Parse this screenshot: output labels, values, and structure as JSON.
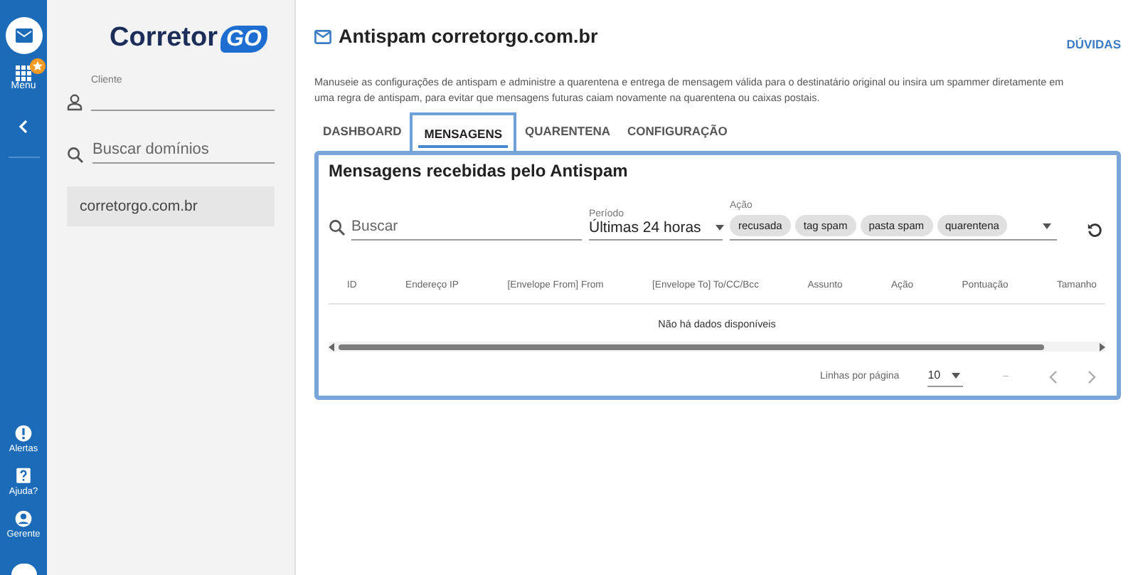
{
  "rail": {
    "menu_label": "Menu",
    "bottom_items": [
      {
        "kind": "alert",
        "label": "Alertas"
      },
      {
        "kind": "help",
        "label": "Ajuda?"
      },
      {
        "kind": "user",
        "label": "Gerente"
      }
    ]
  },
  "sidebar": {
    "logo": {
      "text": "Corretor",
      "mark": "GO"
    },
    "client_field": {
      "label": "Cliente"
    },
    "search": {
      "placeholder": "Buscar domínios"
    },
    "domains": [
      {
        "name": "corretorgo.com.br",
        "selected": true
      }
    ]
  },
  "header": {
    "title": "Antispam corretorgo.com.br",
    "help_link": "DÚVIDAS",
    "description": "Manuseie as configurações de antispam e administre a quarentena e entrega de mensagem válida para o destinatário original ou insira um spammer diretamente em uma regra de antispam, para evitar que mensagens futuras caiam novamente na quarentena ou caixas postais."
  },
  "tabs": [
    {
      "label": "DASHBOARD",
      "selected": false
    },
    {
      "label": "MENSAGENS",
      "selected": true
    },
    {
      "label": "QUARENTENA",
      "selected": false
    },
    {
      "label": "CONFIGURAÇÃO",
      "selected": false
    }
  ],
  "card": {
    "title": "Mensagens recebidas pelo Antispam",
    "search": {
      "placeholder": "Buscar"
    },
    "period": {
      "label": "Período",
      "value": "Últimas 24 horas"
    },
    "action": {
      "label": "Ação",
      "chips": [
        "recusada",
        "tag spam",
        "pasta spam",
        "quarentena"
      ]
    },
    "table": {
      "columns": [
        "ID",
        "Endereço IP",
        "[Envelope From] From",
        "[Envelope To] To/CC/Bcc",
        "Assunto",
        "Ação",
        "Pontuação",
        "Tamanho"
      ],
      "empty_message": "Não há dados disponíveis"
    },
    "pagination": {
      "rows_label": "Linhas por página",
      "rows_value": "10",
      "range": "–"
    }
  }
}
